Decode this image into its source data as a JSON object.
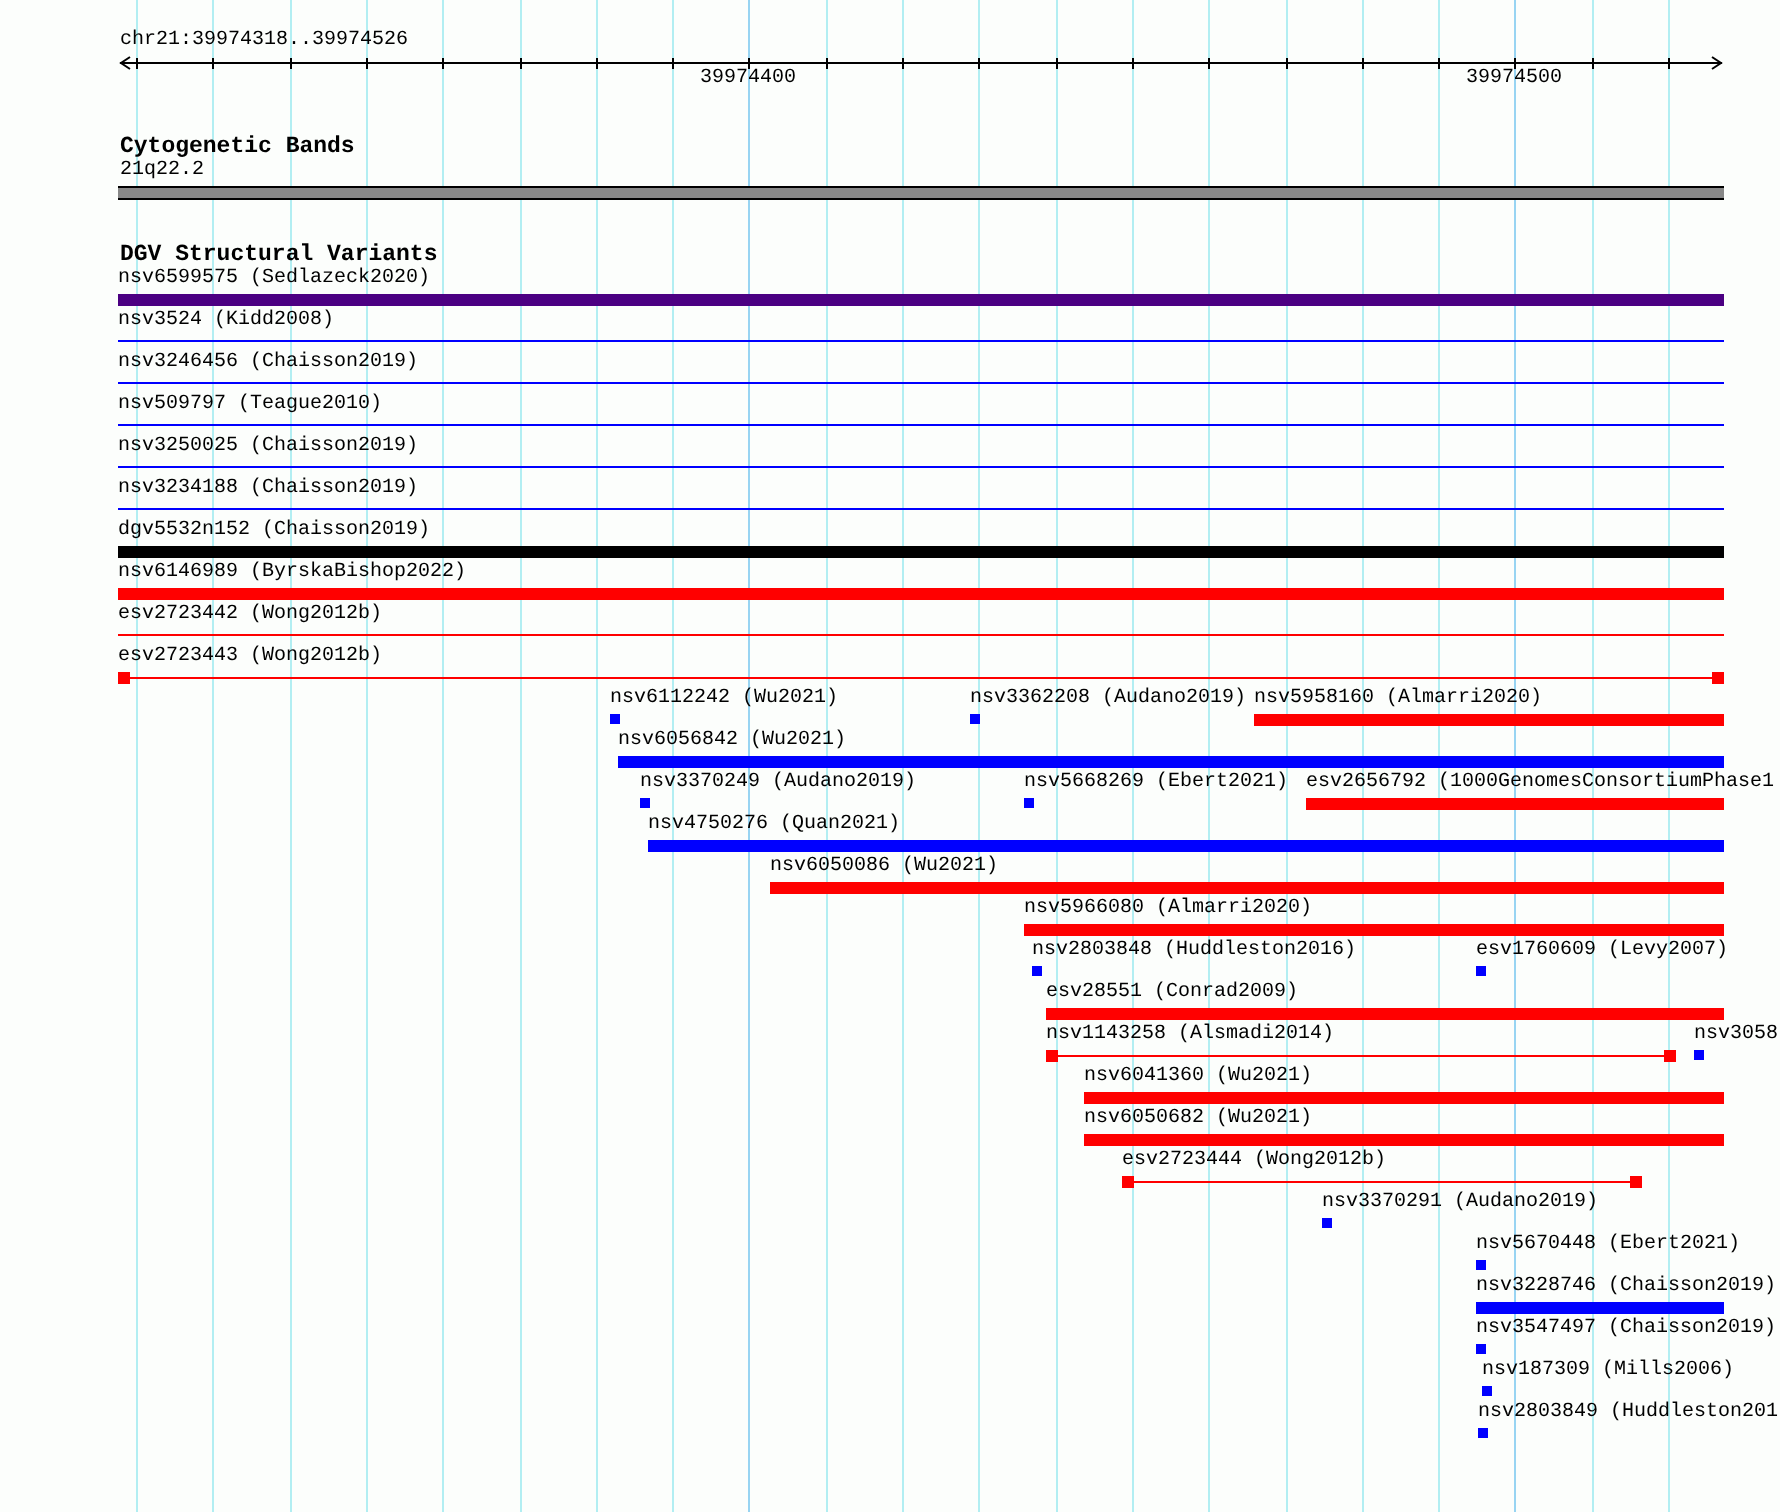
{
  "ruler": {
    "location": "chr21:39974318..39974526",
    "tick_labels": [
      "39974400",
      "39974500"
    ]
  },
  "cytogenetic_bands": {
    "title": "Cytogenetic Bands",
    "band": "21q22.2"
  },
  "dgv_track": {
    "title": "DGV Structural Variants",
    "rows": [
      {
        "features": [
          {
            "label": "nsv6599575 (Sedlazeck2020)",
            "kind": "bar",
            "color": "#4b0082"
          }
        ]
      },
      {
        "features": [
          {
            "label": "nsv3524 (Kidd2008)",
            "kind": "line",
            "color": "#0000ff"
          }
        ]
      },
      {
        "features": [
          {
            "label": "nsv3246456 (Chaisson2019)",
            "kind": "line",
            "color": "#0000ff"
          }
        ]
      },
      {
        "features": [
          {
            "label": "nsv509797 (Teague2010)",
            "kind": "line",
            "color": "#0000ff"
          }
        ]
      },
      {
        "features": [
          {
            "label": "nsv3250025 (Chaisson2019)",
            "kind": "line",
            "color": "#0000ff"
          }
        ]
      },
      {
        "features": [
          {
            "label": "nsv3234188 (Chaisson2019)",
            "kind": "line",
            "color": "#0000ff"
          }
        ]
      },
      {
        "features": [
          {
            "label": "dgv5532n152 (Chaisson2019)",
            "kind": "bar",
            "color": "#000000"
          }
        ]
      },
      {
        "features": [
          {
            "label": "nsv6146989 (ByrskaBishop2022)",
            "kind": "bar",
            "color": "#ff0000"
          }
        ]
      },
      {
        "features": [
          {
            "label": "esv2723442 (Wong2012b)",
            "kind": "line",
            "color": "#ff0000"
          }
        ]
      },
      {
        "features": [
          {
            "label": "esv2723443 (Wong2012b)",
            "kind": "capped",
            "color": "#ff0000"
          }
        ]
      },
      {
        "features": [
          {
            "label": "nsv6112242 (Wu2021)",
            "kind": "point",
            "color": "#0000ff"
          },
          {
            "label": "nsv3362208 (Audano2019)",
            "kind": "point",
            "color": "#0000ff"
          },
          {
            "label": "nsv5958160 (Almarri2020)",
            "kind": "bar",
            "color": "#ff0000"
          }
        ]
      },
      {
        "features": [
          {
            "label": "nsv6056842 (Wu2021)",
            "kind": "bar",
            "color": "#0000ff"
          }
        ]
      },
      {
        "features": [
          {
            "label": "nsv3370249 (Audano2019)",
            "kind": "point",
            "color": "#0000ff"
          },
          {
            "label": "nsv5668269 (Ebert2021)",
            "kind": "point",
            "color": "#0000ff"
          },
          {
            "label": "esv2656792 (1000GenomesConsortiumPhase1",
            "kind": "bar",
            "color": "#ff0000"
          }
        ]
      },
      {
        "features": [
          {
            "label": "nsv4750276 (Quan2021)",
            "kind": "bar",
            "color": "#0000ff"
          }
        ]
      },
      {
        "features": [
          {
            "label": "nsv6050086 (Wu2021)",
            "kind": "bar",
            "color": "#ff0000"
          }
        ]
      },
      {
        "features": [
          {
            "label": "nsv5966080 (Almarri2020)",
            "kind": "bar",
            "color": "#ff0000"
          }
        ]
      },
      {
        "features": [
          {
            "label": "nsv2803848 (Huddleston2016)",
            "kind": "point",
            "color": "#0000ff"
          },
          {
            "label": "esv1760609 (Levy2007)",
            "kind": "point",
            "color": "#0000ff"
          }
        ]
      },
      {
        "features": [
          {
            "label": "esv28551 (Conrad2009)",
            "kind": "bar",
            "color": "#ff0000"
          }
        ]
      },
      {
        "features": [
          {
            "label": "nsv1143258 (Alsmadi2014)",
            "kind": "capped",
            "color": "#ff0000"
          },
          {
            "label": "nsv3058",
            "kind": "point",
            "color": "#0000ff"
          }
        ]
      },
      {
        "features": [
          {
            "label": "nsv6041360 (Wu2021)",
            "kind": "bar",
            "color": "#ff0000"
          }
        ]
      },
      {
        "features": [
          {
            "label": "nsv6050682 (Wu2021)",
            "kind": "bar",
            "color": "#ff0000"
          }
        ]
      },
      {
        "features": [
          {
            "label": "esv2723444 (Wong2012b)",
            "kind": "capped",
            "color": "#ff0000"
          }
        ]
      },
      {
        "features": [
          {
            "label": "nsv3370291 (Audano2019)",
            "kind": "point",
            "color": "#0000ff"
          }
        ]
      },
      {
        "features": [
          {
            "label": "nsv5670448 (Ebert2021)",
            "kind": "point",
            "color": "#0000ff"
          }
        ]
      },
      {
        "features": [
          {
            "label": "nsv3228746 (Chaisson2019)",
            "kind": "bar",
            "color": "#0000ff"
          }
        ]
      },
      {
        "features": [
          {
            "label": "nsv3547497 (Chaisson2019)",
            "kind": "point",
            "color": "#0000ff"
          }
        ]
      },
      {
        "features": [
          {
            "label": "nsv187309 (Mills2006)",
            "kind": "point",
            "color": "#0000ff"
          }
        ]
      },
      {
        "features": [
          {
            "label": "nsv2803849 (Huddleston201",
            "kind": "point",
            "color": "#0000ff"
          }
        ]
      }
    ]
  }
}
